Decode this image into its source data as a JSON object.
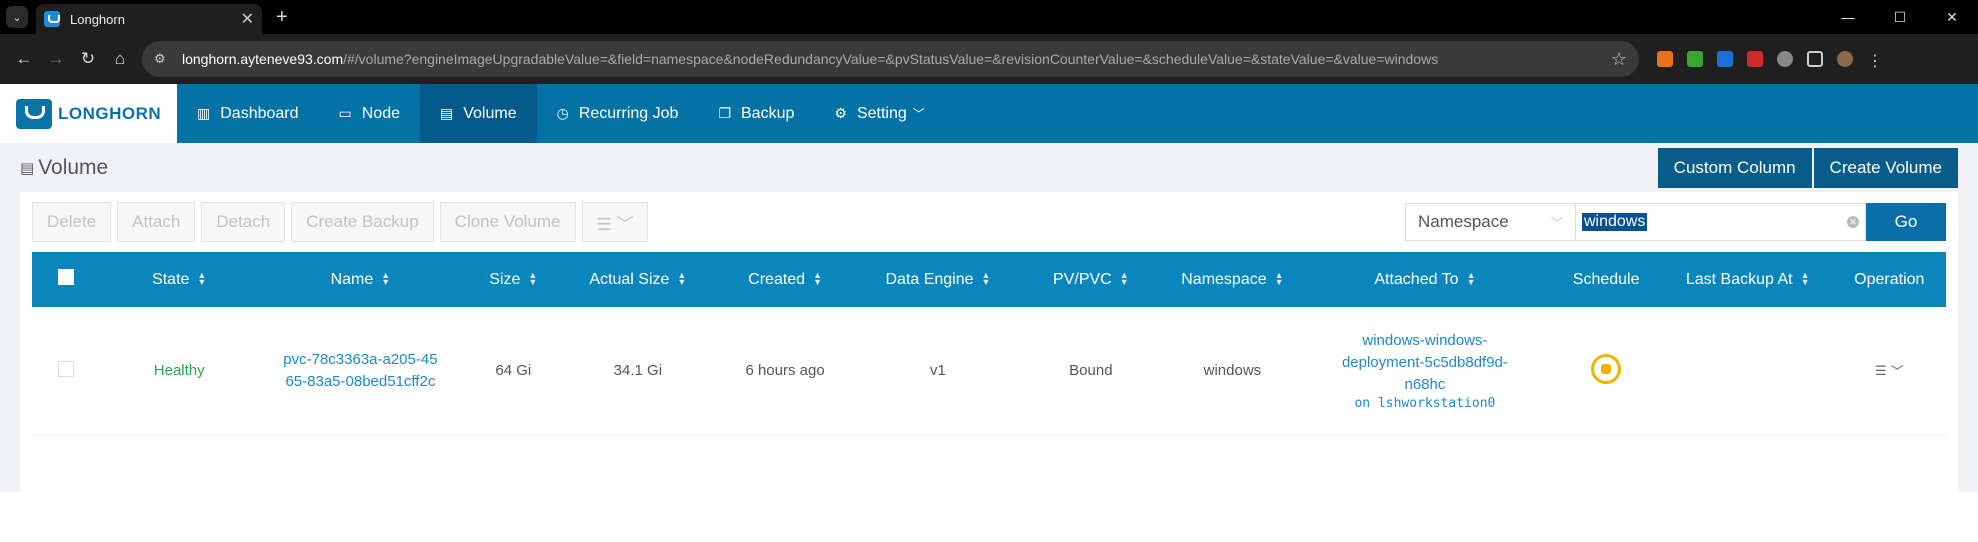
{
  "browser": {
    "tab_title": "Longhorn",
    "new_tab": "+",
    "url_host": "longhorn.ayteneve93.com",
    "url_rest": "/#/volume?engineImageUpgradableValue=&field=namespace&nodeRedundancyValue=&pvStatusValue=&revisionCounterValue=&scheduleValue=&stateValue=&value=windows"
  },
  "header": {
    "logo_text": "LONGHORN",
    "nav": [
      {
        "label": "Dashboard",
        "icon": "bar-chart-icon"
      },
      {
        "label": "Node",
        "icon": "laptop-icon"
      },
      {
        "label": "Volume",
        "icon": "database-icon"
      },
      {
        "label": "Recurring Job",
        "icon": "clock-icon"
      },
      {
        "label": "Backup",
        "icon": "copy-icon"
      },
      {
        "label": "Setting",
        "icon": "gear-icon"
      }
    ]
  },
  "page": {
    "title": "Volume",
    "custom_column": "Custom Column",
    "create_volume": "Create Volume"
  },
  "toolbar": {
    "delete": "Delete",
    "attach": "Attach",
    "detach": "Detach",
    "create_backup": "Create Backup",
    "clone_volume": "Clone Volume"
  },
  "search": {
    "field": "Namespace",
    "value": "windows",
    "go": "Go"
  },
  "table": {
    "columns": [
      "State",
      "Name",
      "Size",
      "Actual Size",
      "Created",
      "Data Engine",
      "PV/PVC",
      "Namespace",
      "Attached To",
      "Schedule",
      "Last Backup At",
      "Operation"
    ],
    "rows": [
      {
        "state": "Healthy",
        "name_line1": "pvc-78c3363a-a205-45",
        "name_line2": "65-83a5-08bed51cff2c",
        "size": "64 Gi",
        "actual_size": "34.1 Gi",
        "created": "6 hours ago",
        "data_engine": "v1",
        "pv_pvc": "Bound",
        "namespace": "windows",
        "attached_line1": "windows-windows-",
        "attached_line2": "deployment-5c5db8df9d-",
        "attached_line3": "n68hc",
        "attached_node": "on lshworkstation0",
        "last_backup": ""
      }
    ]
  },
  "colors": {
    "header_bg": "#0572a6",
    "table_header_bg": "#0b86bd",
    "healthy": "#27a745",
    "link": "#1c8ac8"
  }
}
